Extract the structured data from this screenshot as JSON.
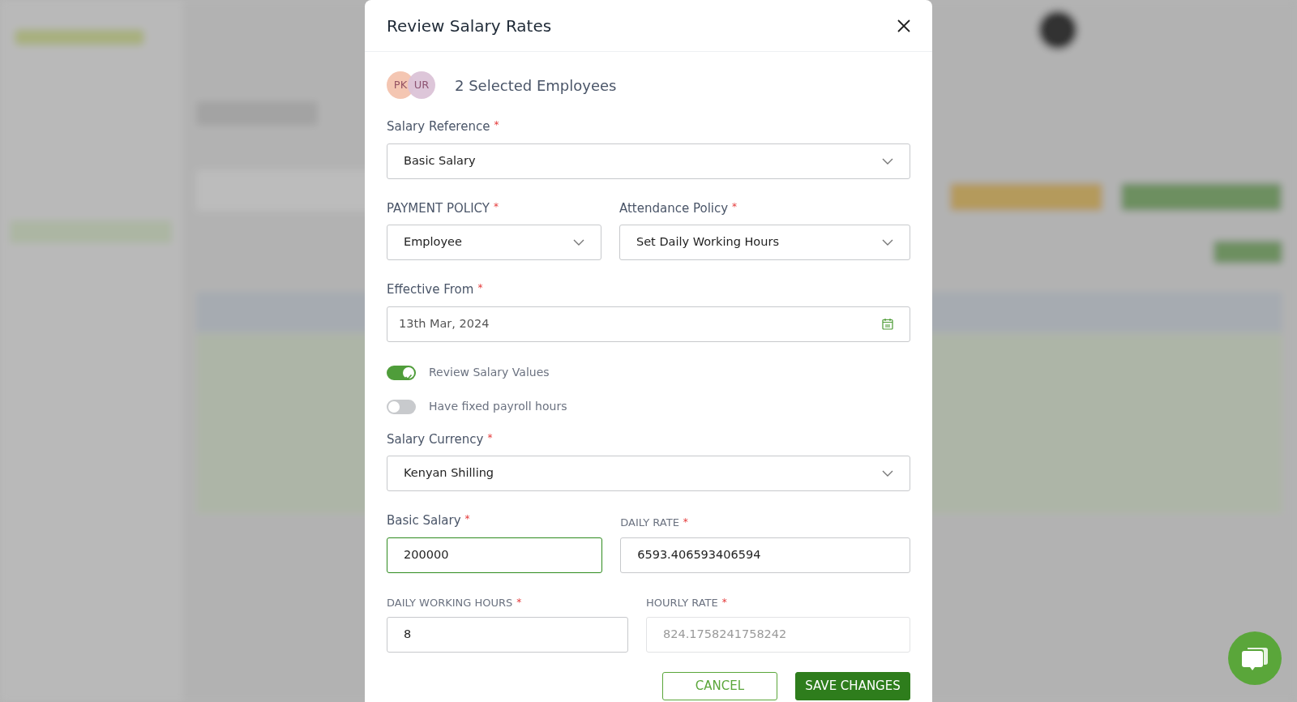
{
  "dialog": {
    "title": "Review Salary Rates",
    "selection": {
      "avatars": [
        {
          "initials": "PK",
          "color": "#f4c3ae"
        },
        {
          "initials": "UR",
          "color": "#dcc3d8"
        }
      ],
      "text": "2 Selected Employees"
    },
    "rows": [
      [
        {
          "kind": "select",
          "label": "Salary Reference",
          "required_mark": "*",
          "value": "Basic Salary"
        }
      ],
      [
        {
          "kind": "select",
          "label": "PAYMENT POLICY",
          "required_mark": "*",
          "value": "Employee"
        },
        {
          "kind": "select",
          "label": "Attendance Policy",
          "required_mark": "*",
          "value": "Set Daily Working Hours"
        }
      ],
      [
        {
          "kind": "date",
          "label": "Effective From",
          "required_mark": "*",
          "value": "13th Mar, 2024"
        }
      ],
      [
        {
          "kind": "toggle",
          "label": "Review Salary Values",
          "on": true
        }
      ],
      [
        {
          "kind": "toggle",
          "label": "Have fixed payroll hours",
          "on": false
        }
      ],
      [
        {
          "kind": "select",
          "label": "Salary Currency",
          "required_mark": "*",
          "value": "Kenyan Shilling"
        }
      ],
      [
        {
          "kind": "input",
          "label": "Basic Salary",
          "required_mark": "*",
          "value": "200000",
          "focused": true,
          "disabled": false,
          "small_label": false
        },
        {
          "kind": "input",
          "label": "DAILY RATE",
          "required_mark": "*",
          "value": "6593.406593406594",
          "focused": false,
          "disabled": false,
          "small_label": true
        }
      ],
      [
        {
          "kind": "input",
          "label": "DAILY WORKING HOURS",
          "required_mark": "*",
          "value": "8",
          "focused": false,
          "disabled": false,
          "small_label": true
        },
        {
          "kind": "input",
          "label": "HOURLY RATE",
          "required_mark": "*",
          "value": "824.1758241758242",
          "focused": false,
          "disabled": true,
          "small_label": true
        }
      ]
    ],
    "buttons": [
      {
        "kind": "outline",
        "label": "CANCEL"
      },
      {
        "kind": "primary",
        "label": "SAVE CHANGES"
      }
    ]
  }
}
